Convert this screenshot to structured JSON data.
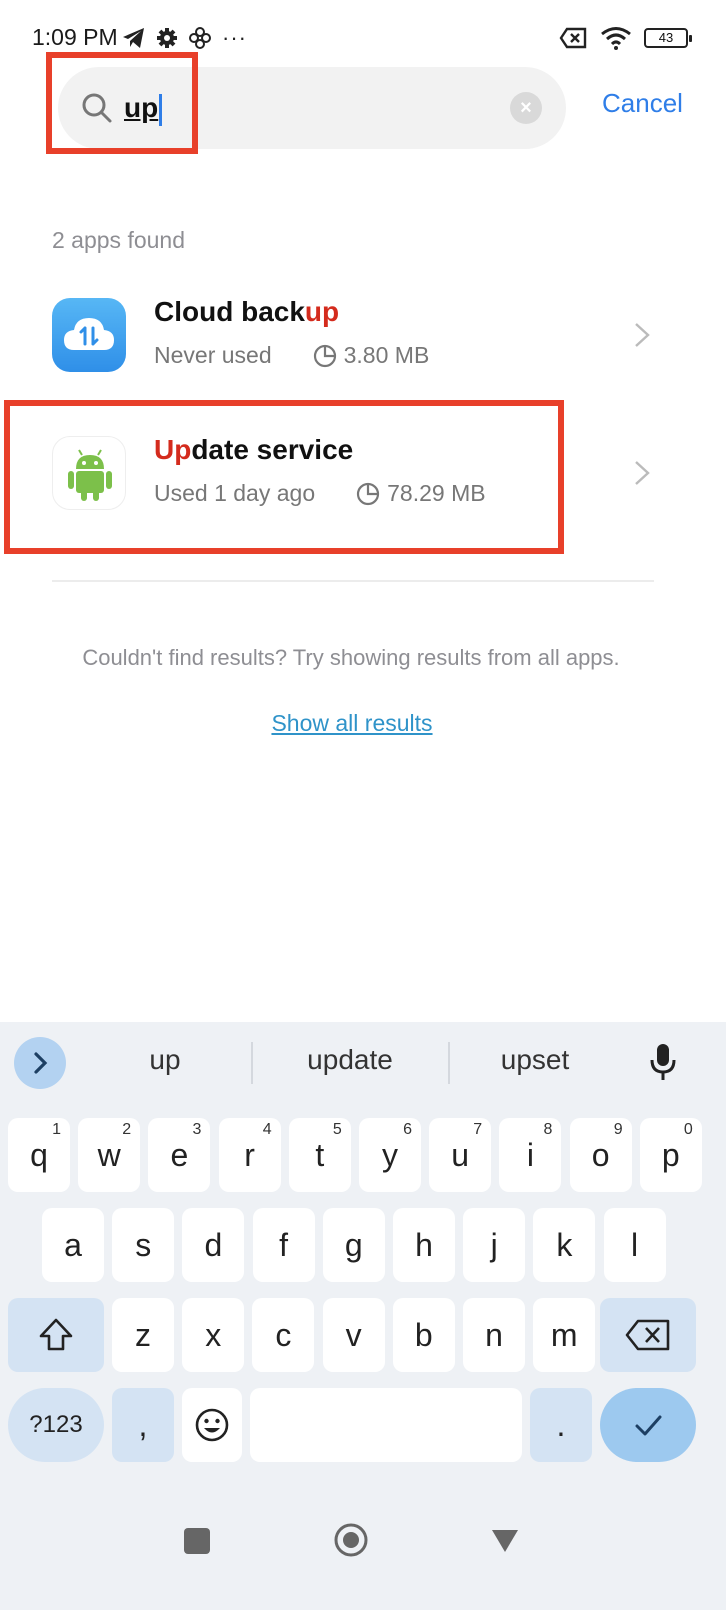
{
  "status_bar": {
    "time": "1:09 PM",
    "battery": "43"
  },
  "search": {
    "query": "up",
    "cancel_label": "Cancel"
  },
  "results": {
    "count_label": "2 apps found",
    "apps": [
      {
        "name_plain": "Cloud back",
        "name_highlight": "up",
        "usage": "Never used",
        "size": "3.80 MB"
      },
      {
        "name_highlight": "Up",
        "name_plain": "date service",
        "usage": "Used 1 day ago",
        "size": "78.29 MB"
      }
    ],
    "hint": "Couldn't find results? Try showing results from all apps.",
    "show_all_label": "Show all results"
  },
  "keyboard": {
    "suggestions": [
      "up",
      "update",
      "upset"
    ],
    "row1": [
      {
        "k": "q",
        "n": "1"
      },
      {
        "k": "w",
        "n": "2"
      },
      {
        "k": "e",
        "n": "3"
      },
      {
        "k": "r",
        "n": "4"
      },
      {
        "k": "t",
        "n": "5"
      },
      {
        "k": "y",
        "n": "6"
      },
      {
        "k": "u",
        "n": "7"
      },
      {
        "k": "i",
        "n": "8"
      },
      {
        "k": "o",
        "n": "9"
      },
      {
        "k": "p",
        "n": "0"
      }
    ],
    "row2": [
      "a",
      "s",
      "d",
      "f",
      "g",
      "h",
      "j",
      "k",
      "l"
    ],
    "row3": [
      "z",
      "x",
      "c",
      "v",
      "b",
      "n",
      "m"
    ],
    "symbols_label": "?123",
    "comma_label": ",",
    "period_label": "."
  },
  "colors": {
    "accent": "#2f7ee8",
    "highlight_text": "#d42b1d",
    "annotation_box": "#e8402a",
    "keyboard_bg": "#eef1f5"
  }
}
